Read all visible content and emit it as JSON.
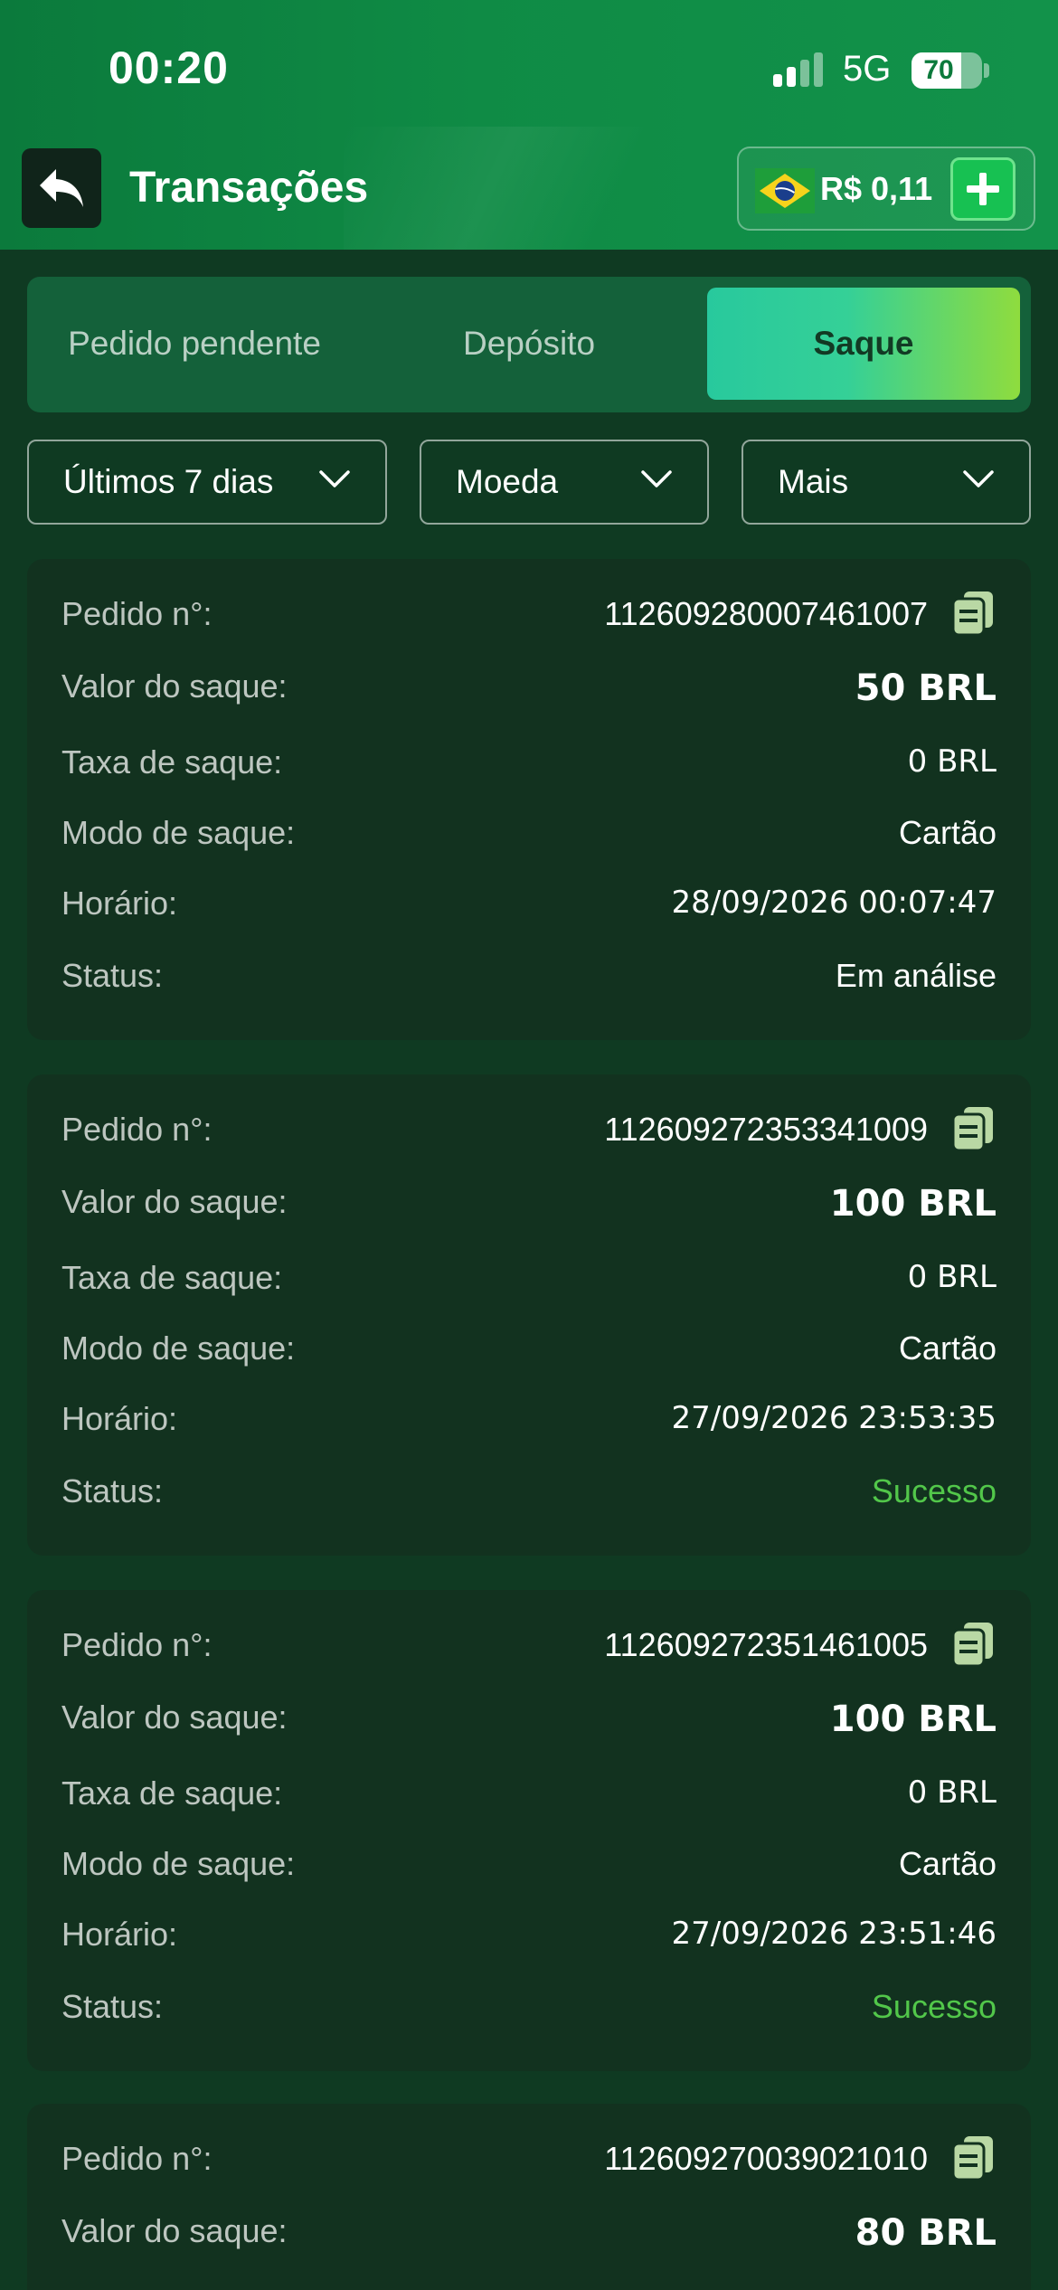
{
  "status_bar": {
    "time": "00:20",
    "network": "5G",
    "battery": "70"
  },
  "header": {
    "title": "Transações",
    "balance": "R$ 0,11",
    "accent_color": "#17c152"
  },
  "tabs": [
    {
      "label": "Pedido pendente",
      "active": false
    },
    {
      "label": "Depósito",
      "active": false
    },
    {
      "label": "Saque",
      "active": true
    }
  ],
  "filters": {
    "period": "Últimos 7 dias",
    "currency": "Moeda",
    "more": "Mais"
  },
  "labels": {
    "order": "Pedido n°:",
    "amount": "Valor do saque:",
    "fee": "Taxa de saque:",
    "mode": "Modo de saque:",
    "time": "Horário:",
    "status": "Status:"
  },
  "transactions": [
    {
      "order": "112609280007461007",
      "amount": "50 BRL",
      "fee": "0 BRL",
      "mode": "Cartão",
      "time": "28/09/2026 00:07:47",
      "status": "Em análise"
    },
    {
      "order": "112609272353341009",
      "amount": "100 BRL",
      "fee": "0 BRL",
      "mode": "Cartão",
      "time": "27/09/2026 23:53:35",
      "status": "Sucesso"
    },
    {
      "order": "112609272351461005",
      "amount": "100 BRL",
      "fee": "0 BRL",
      "mode": "Cartão",
      "time": "27/09/2026 23:51:46",
      "status": "Sucesso"
    },
    {
      "order": "112609270039021010",
      "amount": "80 BRL"
    }
  ],
  "colors": {
    "success": "#52c74a",
    "background": "#0f3a22",
    "card": "#12321f"
  }
}
